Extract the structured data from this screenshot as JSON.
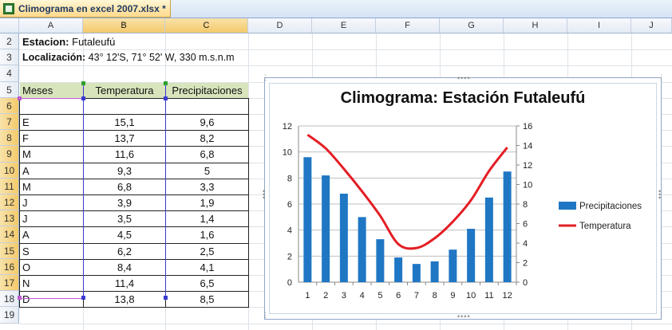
{
  "tab": {
    "title": "Climograma en excel 2007.xlsx *",
    "icon": "excel-file-icon"
  },
  "columns": [
    "A",
    "B",
    "C",
    "D",
    "E",
    "F",
    "G",
    "H",
    "I",
    "J"
  ],
  "rows": [
    "2",
    "3",
    "4",
    "5",
    "6",
    "7",
    "8",
    "9",
    "10",
    "11",
    "12",
    "13",
    "14",
    "15",
    "16",
    "17",
    "18",
    "19"
  ],
  "info": {
    "station_label": "Estacion:",
    "station_value": " Futaleufú",
    "location_label": "Localización:",
    "location_value": " 43° 12'S, 71° 52' W, 330 m.s.n.m"
  },
  "table": {
    "headers": [
      "Meses",
      "Temperatura",
      "Precipitaciones"
    ],
    "rows": [
      [
        "E",
        "15,1",
        "9,6"
      ],
      [
        "F",
        "13,7",
        "8,2"
      ],
      [
        "M",
        "11,6",
        "6,8"
      ],
      [
        "A",
        "9,3",
        "5"
      ],
      [
        "M",
        "6,8",
        "3,3"
      ],
      [
        "J",
        "3,9",
        "1,9"
      ],
      [
        "J",
        "3,5",
        "1,4"
      ],
      [
        "A",
        "4,5",
        "1,6"
      ],
      [
        "S",
        "6,2",
        "2,5"
      ],
      [
        "O",
        "8,4",
        "4,1"
      ],
      [
        "N",
        "11,4",
        "6,5"
      ],
      [
        "D",
        "13,8",
        "8,5"
      ]
    ]
  },
  "chart_data": {
    "type": "bar",
    "title": "Climograma: Estación Futaleufú",
    "categories": [
      "1",
      "2",
      "3",
      "4",
      "5",
      "6",
      "7",
      "8",
      "9",
      "10",
      "11",
      "12"
    ],
    "series": [
      {
        "name": "Precipitaciones",
        "type": "bar",
        "axis": "left",
        "color": "#1f77c4",
        "values": [
          9.6,
          8.2,
          6.8,
          5,
          3.3,
          1.9,
          1.4,
          1.6,
          2.5,
          4.1,
          6.5,
          8.5
        ]
      },
      {
        "name": "Temperatura",
        "type": "line",
        "axis": "right",
        "color": "#e31e24",
        "values": [
          15.1,
          13.7,
          11.6,
          9.3,
          6.8,
          3.9,
          3.5,
          4.5,
          6.2,
          8.4,
          11.4,
          13.8
        ]
      }
    ],
    "y_left": {
      "min": 0,
      "max": 12,
      "ticks": [
        "0",
        "2",
        "4",
        "6",
        "8",
        "10",
        "12"
      ]
    },
    "y_right": {
      "min": 0,
      "max": 16,
      "ticks": [
        "0",
        "2",
        "4",
        "6",
        "8",
        "10",
        "12",
        "14",
        "16"
      ]
    },
    "grid": true,
    "legend_position": "right"
  }
}
